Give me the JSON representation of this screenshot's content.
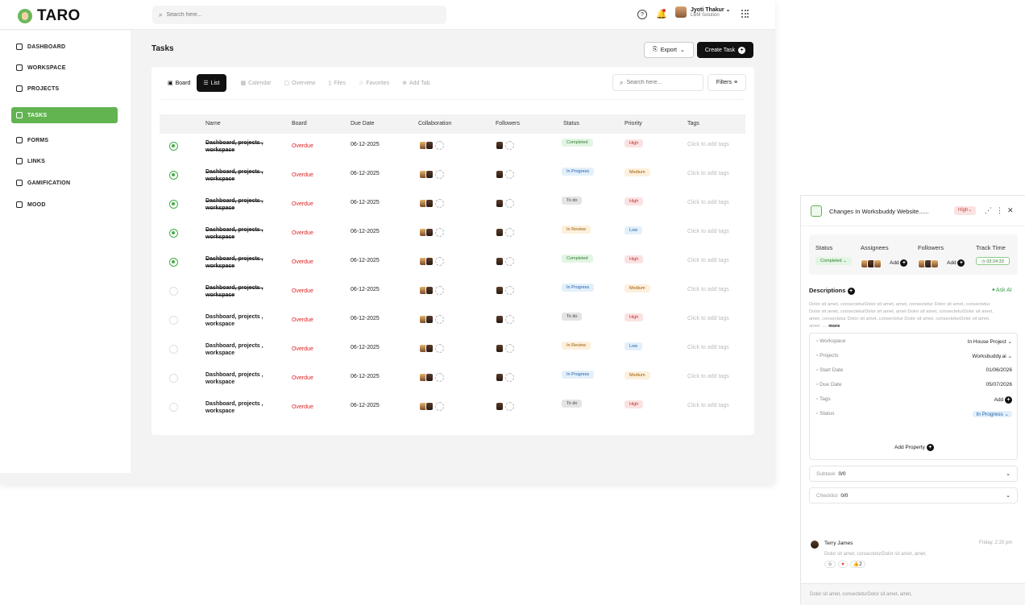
{
  "app": {
    "logo": "TARO"
  },
  "topbar": {
    "search_placeholder": "Search here...",
    "user_name": "Jyoti Thakur",
    "user_org": "LBM Solution"
  },
  "sidebar": {
    "items": [
      "DASHBOARD",
      "WORKSPACE",
      "PROJECTS",
      "TASKS",
      "FORMS",
      "LINKS",
      "GAMIFICATION",
      "MOOD"
    ],
    "active": "TASKS"
  },
  "page": {
    "title": "Tasks",
    "export_label": "Export",
    "create_label": "Create Task"
  },
  "tabs": {
    "board": "Board",
    "list": "List",
    "calendar": "Calendar",
    "overview": "Overview",
    "files": "Files",
    "favorites": "Favorites",
    "add_tab": "Add Tab",
    "search_placeholder": "Search here...",
    "filters": "Filters"
  },
  "table": {
    "headers": [
      "Name",
      "Board",
      "Due Date",
      "Collaboration",
      "Followers",
      "Status",
      "Priority",
      "Tags"
    ],
    "rows": [
      {
        "name": "Dashboard, projects , workspace",
        "board": "Overdue",
        "due": "06-12-2025",
        "status": "Completed",
        "priority": "High",
        "tags": "Click to add  tags",
        "done": true
      },
      {
        "name": "Dashboard, projects , workspace",
        "board": "Overdue",
        "due": "06-12-2025",
        "status": "In Progress",
        "priority": "Medium",
        "tags": "Click to add  tags",
        "done": true
      },
      {
        "name": "Dashboard, projects , workspace",
        "board": "Overdue",
        "due": "06-12-2025",
        "status": "To do",
        "priority": "High",
        "tags": "Click to add  tags",
        "done": true
      },
      {
        "name": "Dashboard, projects , workspace",
        "board": "Overdue",
        "due": "06-12-2025",
        "status": "In Review",
        "priority": "Low",
        "tags": "Click to add  tags",
        "done": true
      },
      {
        "name": "Dashboard, projects , workspace",
        "board": "Overdue",
        "due": "06-12-2025",
        "status": "Completed",
        "priority": "High",
        "tags": "Click to add  tags",
        "done": true
      },
      {
        "name": "Dashboard, projects , workspace",
        "board": "Overdue",
        "due": "06-12-2025",
        "status": "In Progress",
        "priority": "Medium",
        "tags": "Click to add  tags",
        "done": false,
        "strike": true
      },
      {
        "name": "Dashboard, projects , workspace",
        "board": "Overdue",
        "due": "06-12-2025",
        "status": "To do",
        "priority": "High",
        "tags": "Click to add  tags",
        "done": false
      },
      {
        "name": "Dashboard, projects , workspace",
        "board": "Overdue",
        "due": "06-12-2025",
        "status": "In Review",
        "priority": "Low",
        "tags": "Click to add  tags",
        "done": false
      },
      {
        "name": "Dashboard, projects , workspace",
        "board": "Overdue",
        "due": "06-12-2025",
        "status": "In Progress",
        "priority": "Medium",
        "tags": "Click to add  tags",
        "done": false
      },
      {
        "name": "Dashboard, projects , workspace",
        "board": "Overdue",
        "due": "06-12-2025",
        "status": "To do",
        "priority": "High",
        "tags": "Click to add  tags",
        "done": false
      }
    ]
  },
  "status_colors": {
    "Completed": [
      "#e3f5e4",
      "#2e7d32"
    ],
    "In Progress": [
      "#e3f0fb",
      "#1f5fa8"
    ],
    "To do": [
      "#e4e4e4",
      "#444444"
    ],
    "In Review": [
      "#fdf0dc",
      "#9a5b00"
    ]
  },
  "priority_colors": {
    "High": [
      "#fbe2e2",
      "#b33"
    ],
    "Medium": [
      "#fdf0dc",
      "#9a5b00"
    ],
    "Low": [
      "#e3f0fb",
      "#1f5fa8"
    ]
  },
  "detail": {
    "title": "Changes In Worksbuddy Website......",
    "priority": "High",
    "status_label": "Status",
    "status_value": "Completed",
    "assignees_label": "Assignees",
    "followers_label": "Followers",
    "add_label": "Add",
    "track_label": "Track Time",
    "track_value": "03:24:33",
    "desc_title": "Descriptions",
    "ask_ai": "Ask AI",
    "desc_text": "Dolor sit amet, consecteturDolor sit amet, amet, consectetur Dolor sit amet, consectetur Dolor sit amet, consecteturDolor sit amet, amet Dolor sit amet, consecteturDolor sit amet, amet, consectetur Dolor sit amet, consectetur Dolor sit amet, consecteturDolor sit amet, amet. ....",
    "desc_more": "more",
    "props": [
      {
        "k": "Workspace",
        "v": "In House Project"
      },
      {
        "k": "Projects",
        "v": "Worksbuddy.ai"
      },
      {
        "k": "Start Date",
        "v": "01/06/2026"
      },
      {
        "k": "Due Date",
        "v": "05/07/2026"
      },
      {
        "k": "Tags",
        "v": "Add"
      },
      {
        "k": "Status",
        "v": "In Progress"
      }
    ],
    "add_property": "Add Property",
    "subtask_label": "Subtask",
    "subtask_value": "0/0",
    "checklist_label": "Checklist",
    "checklist_value": "0/0",
    "comment_name": "Terry James",
    "comment_time": "Friday, 2:20 pm",
    "comment_text": "Dolor sit amet, consecteturDolor sit amet, amet,",
    "react_count": "2",
    "reply_text": "Dolor sit amet, consecteturDolor sit amet, amet,"
  }
}
